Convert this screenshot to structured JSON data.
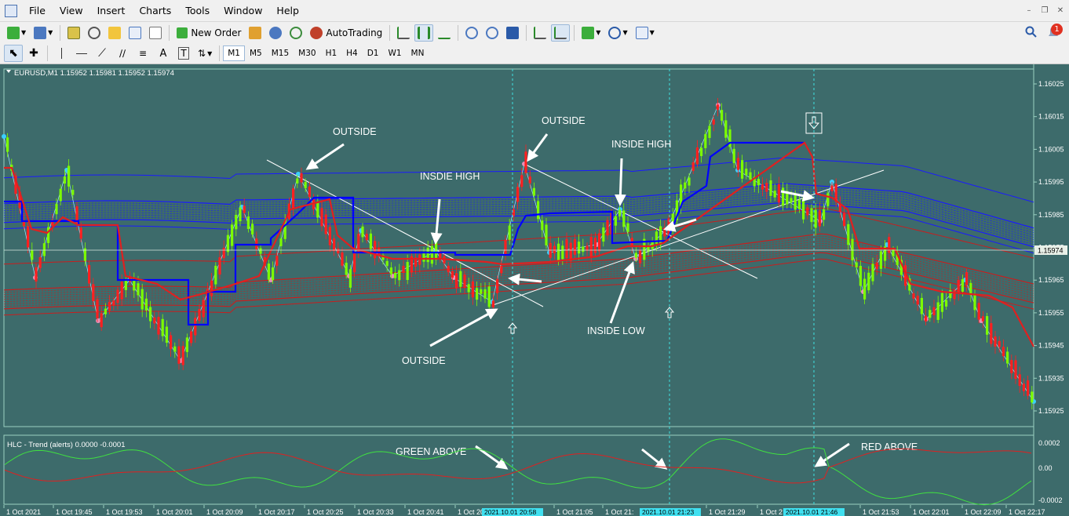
{
  "menu": {
    "items": [
      "File",
      "View",
      "Insert",
      "Charts",
      "Tools",
      "Window",
      "Help"
    ]
  },
  "toolbar1": {
    "new_order_label": "New Order",
    "autotrading_label": "AutoTrading"
  },
  "toolbar2": {
    "timeframes": [
      "M1",
      "M5",
      "M15",
      "M30",
      "H1",
      "H4",
      "D1",
      "W1",
      "MN"
    ],
    "active_timeframe": "M1"
  },
  "notification_badge": "1",
  "chart": {
    "info": "EURUSD,M1  1.15952 1.15981 1.15952 1.15974",
    "price_levels": [
      "1.16025",
      "1.16015",
      "1.16005",
      "1.15995",
      "1.15985",
      "1.15975",
      "1.15965",
      "1.15955",
      "1.15945",
      "1.15935",
      "1.15925"
    ],
    "current_price": "1.15974",
    "annotations": [
      "OUTSIDE",
      "OUTSIDE",
      "INSDIE HIGH",
      "INSIDE HIGH",
      "OUTSIDE",
      "INSIDE LOW",
      "GREEN ABOVE",
      "RED ABOVE"
    ],
    "colors": {
      "background": "#3d6b6b",
      "bull_candle": "#7cfc00",
      "bear_candle": "#ff2020",
      "blue_band": "#1a1aff",
      "red_band": "#c81e1e",
      "fast_line": "#0000ff",
      "slow_line": "#e02020"
    }
  },
  "indicator": {
    "title": "HLC - Trend (alerts) 0.0000 -0.0001",
    "levels": [
      "0.0002",
      "0.00",
      "-0.0002"
    ]
  },
  "time_axis": {
    "labels": [
      "1 Oct 2021",
      "1 Oct 19:45",
      "1 Oct 19:53",
      "1 Oct 20:01",
      "1 Oct 20:09",
      "1 Oct 20:17",
      "1 Oct 20:25",
      "1 Oct 20:33",
      "1 Oct 20:41",
      "1 Oct 20",
      "1 Oct 21:05",
      "1 Oct 21:",
      "1 Oct 21:29",
      "1 Oct 2",
      "1 Oct 21:53",
      "1 Oct 22:01",
      "1 Oct 22:09",
      "1 Oct 22:17"
    ],
    "highlighted": [
      "2021.10.01 20:58",
      "2021.10.01 21:23",
      "2021.10.01 21:46"
    ]
  }
}
